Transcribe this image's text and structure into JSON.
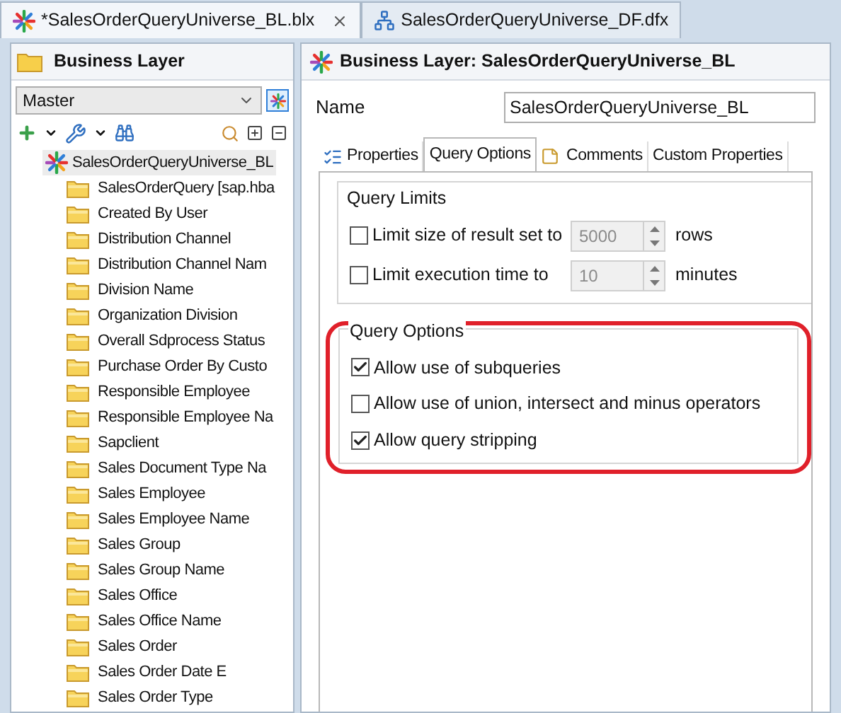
{
  "editor_tabs": [
    {
      "label": "*SalesOrderQueryUniverse_BL.blx",
      "selected": true,
      "kind": "universe"
    },
    {
      "label": "SalesOrderQueryUniverse_DF.dfx",
      "selected": false,
      "kind": "foundation"
    }
  ],
  "left_panel": {
    "title": "Business Layer",
    "view_select": {
      "value": "Master"
    },
    "tree": {
      "label": "SalesOrderQueryUniverse_BL",
      "selected": true,
      "children": [
        {
          "label": "SalesOrderQuery [sap.hba"
        },
        {
          "label": "Created By User"
        },
        {
          "label": "Distribution Channel"
        },
        {
          "label": "Distribution Channel Nam"
        },
        {
          "label": "Division Name"
        },
        {
          "label": "Organization Division"
        },
        {
          "label": "Overall Sdprocess Status"
        },
        {
          "label": "Purchase Order By Custo"
        },
        {
          "label": "Responsible Employee"
        },
        {
          "label": "Responsible Employee Na"
        },
        {
          "label": "Sapclient"
        },
        {
          "label": "Sales Document Type Na"
        },
        {
          "label": "Sales Employee"
        },
        {
          "label": "Sales Employee Name"
        },
        {
          "label": "Sales Group"
        },
        {
          "label": "Sales Group Name"
        },
        {
          "label": "Sales Office"
        },
        {
          "label": "Sales Office Name"
        },
        {
          "label": "Sales Order"
        },
        {
          "label": "Sales Order Date E"
        },
        {
          "label": "Sales Order Type"
        }
      ]
    }
  },
  "right_panel": {
    "title": "Business Layer: SalesOrderQueryUniverse_BL",
    "name_field": {
      "label": "Name",
      "value": "SalesOrderQueryUniverse_BL"
    },
    "tabs": [
      {
        "label": "Properties",
        "selected": false,
        "kind": "properties"
      },
      {
        "label": "Query Options",
        "selected": true,
        "kind": "plain"
      },
      {
        "label": "Comments",
        "selected": false,
        "kind": "comments"
      },
      {
        "label": "Custom Properties",
        "selected": false,
        "kind": "plain"
      }
    ],
    "query_limits": {
      "title": "Query Limits",
      "rows": [
        {
          "label": "Limit size of result set to",
          "checked": false,
          "value": "5000",
          "unit": "rows"
        },
        {
          "label": "Limit execution time to",
          "checked": false,
          "value": "10",
          "unit": "minutes"
        }
      ]
    },
    "query_options": {
      "title": "Query Options",
      "options": [
        {
          "label": "Allow use of subqueries",
          "checked": true
        },
        {
          "label": "Allow use of union, intersect and minus operators",
          "checked": false
        },
        {
          "label": "Allow query stripping",
          "checked": true
        }
      ]
    }
  }
}
